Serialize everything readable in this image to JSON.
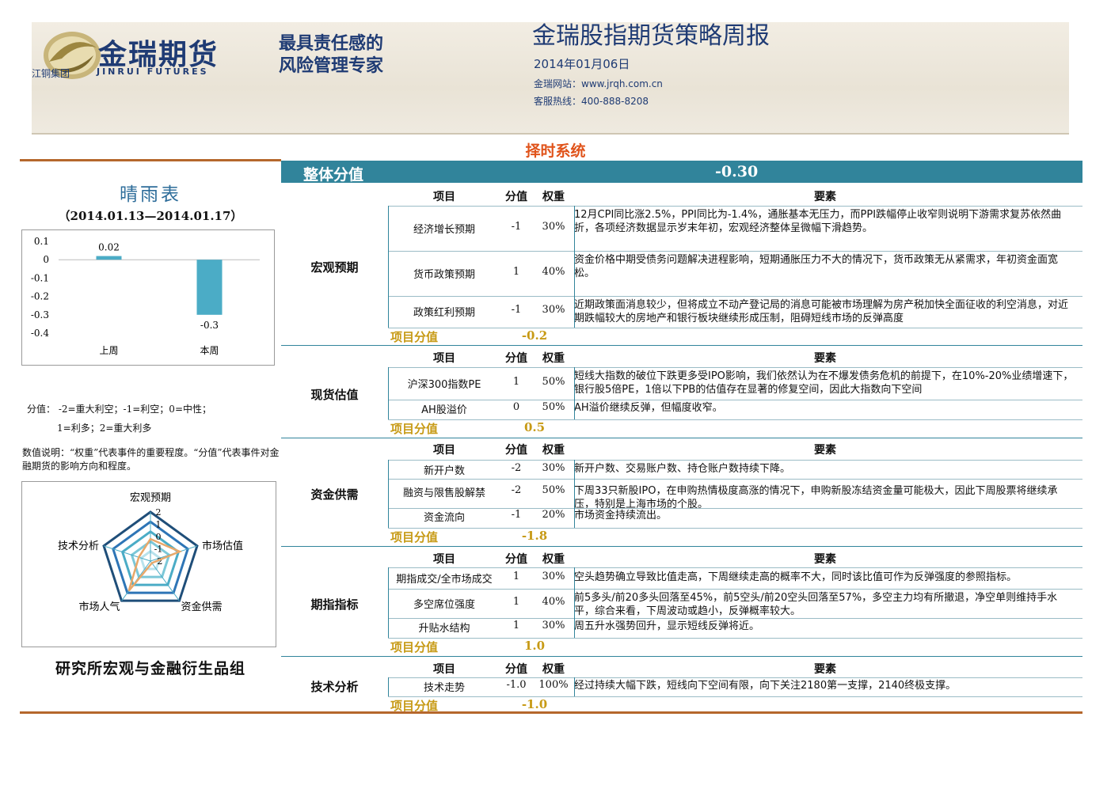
{
  "header": {
    "logo_cn": "金瑞期货",
    "logo_group": "江铜集团",
    "logo_en": "JINRUI FUTURES",
    "slogan_line1": "最具责任感的",
    "slogan_line2": "风险管理专家",
    "title": "金瑞股指期货策略周报",
    "date": "2014年01月06日",
    "website": "金瑞网站：www.jrqh.com.cn",
    "hotline": "客服热线：400-888-8208"
  },
  "section_title": "择时系统",
  "left_panel": {
    "weather_title": "晴雨表",
    "date_range": "（2014.01.13—2014.01.17）",
    "score_legend_line1": "分值： -2=重大利空；-1=利空；0=中性；",
    "score_legend_line2": "1=利多；2=重大利多",
    "note": "数值说明：“权重”代表事件的重要程度。“分值”代表事件对金融期货的影响方向和程度。",
    "group_name": "研究所宏观与金融衍生品组"
  },
  "chart_data": [
    {
      "type": "bar",
      "categories": [
        "上周",
        "本周"
      ],
      "values": [
        0.02,
        -0.3
      ],
      "data_labels": [
        "0.02",
        "-0.3"
      ],
      "ylim": [
        -0.4,
        0.1
      ],
      "yticks": [
        "0.1",
        "0",
        "-0.1",
        "-0.2",
        "-0.3",
        "-0.4"
      ],
      "title": "",
      "xlabel": "",
      "ylabel": "",
      "bar_color": "#4bacc6"
    },
    {
      "type": "radar",
      "axes": [
        "宏观预期",
        "市场估值",
        "资金供需",
        "市场人气",
        "技术分析"
      ],
      "ticks": [
        "2",
        "1",
        "0",
        "-1",
        "-2"
      ],
      "range": [
        -2,
        2
      ],
      "values": [
        -0.2,
        0.5,
        -1.8,
        1.0,
        -1.0
      ],
      "title": ""
    }
  ],
  "table": {
    "overall_label": "整体分值",
    "overall_value": "-0.30",
    "col_item": "项目",
    "col_score": "分值",
    "col_weight": "权重",
    "col_factor": "要素",
    "summary_label": "项目分值",
    "groups": [
      {
        "name": "宏观预期",
        "summary": "-0.2",
        "rows": [
          {
            "item": "经济增长预期",
            "score": "-1",
            "weight": "30%",
            "factor": "12月CPI同比涨2.5%，PPI同比为-1.4%，通胀基本无压力，而PPI跌幅停止收窄则说明下游需求复苏依然曲折，各项经济数据显示岁末年初，宏观经济整体呈微幅下滑趋势。"
          },
          {
            "item": "货币政策预期",
            "score": "1",
            "weight": "40%",
            "factor": "资金价格中期受债务问题解决进程影响，短期通胀压力不大的情况下，货币政策无从紧需求，年初资金面宽松。"
          },
          {
            "item": "政策红利预期",
            "score": "-1",
            "weight": "30%",
            "factor": "近期政策面消息较少，但将成立不动产登记局的消息可能被市场理解为房产税加快全面征收的利空消息，对近期跌幅较大的房地产和银行板块继续形成压制，阻碍短线市场的反弹高度"
          }
        ]
      },
      {
        "name": "现货估值",
        "summary": "0.5",
        "rows": [
          {
            "item": "沪深300指数PE",
            "score": "1",
            "weight": "50%",
            "factor": "短线大指数的破位下跌更多受IPO影响，我们依然认为在不爆发债务危机的前提下，在10%-20%业绩增速下，银行股5倍PE，1倍以下PB的估值存在显著的修复空间，因此大指数向下空间"
          },
          {
            "item": "AH股溢价",
            "score": "0",
            "weight": "50%",
            "factor": "AH溢价继续反弹，但幅度收窄。"
          }
        ]
      },
      {
        "name": "资金供需",
        "summary": "-1.8",
        "rows": [
          {
            "item": "新开户数",
            "score": "-2",
            "weight": "30%",
            "factor": "新开户数、交易账户数、持仓账户数持续下降。"
          },
          {
            "item": "融资与限售股解禁",
            "score": "-2",
            "weight": "50%",
            "factor": "下周33只新股IPO，在申购热情极度高涨的情况下，申购新股冻结资金量可能极大，因此下周股票将继续承压，特别是上海市场的个股。"
          },
          {
            "item": "资金流向",
            "score": "-1",
            "weight": "20%",
            "factor": "市场资金持续流出。"
          }
        ]
      },
      {
        "name": "期指指标",
        "summary": "1.0",
        "rows": [
          {
            "item": "期指成交/全市场成交",
            "score": "1",
            "weight": "30%",
            "factor": "空头趋势确立导致比值走高，下周继续走高的概率不大，同时该比值可作为反弹强度的参照指标。"
          },
          {
            "item": "多空席位强度",
            "score": "1",
            "weight": "40%",
            "factor": "前5多头/前20多头回落至45%，前5空头/前20空头回落至57%，多空主力均有所撤退，净空单则维持手水平，综合来看，下周波动或趋小，反弹概率较大。"
          },
          {
            "item": "升贴水结构",
            "score": "1",
            "weight": "30%",
            "factor": "周五升水强势回升，显示短线反弹将近。"
          }
        ]
      },
      {
        "name": "技术分析",
        "summary": "-1.0",
        "rows": [
          {
            "item": "技术走势",
            "score": "-1.0",
            "weight": "100%",
            "factor": "经过持续大幅下跌，短线向下空间有限，向下关注2180第一支撑，2140终极支撑。"
          }
        ]
      }
    ]
  }
}
